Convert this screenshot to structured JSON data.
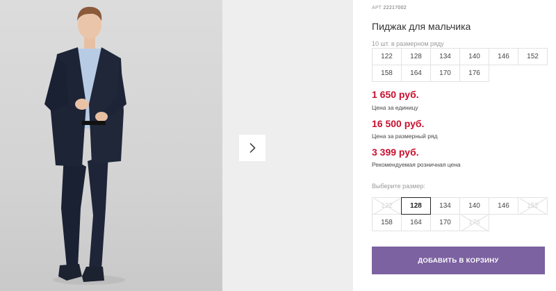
{
  "product": {
    "article_prefix": "АРТ",
    "article_number": "22217002",
    "title": "Пиджак для мальчика"
  },
  "pack": {
    "label": "10 шт. в размерном ряду",
    "sizes": [
      "122",
      "128",
      "134",
      "140",
      "146",
      "152",
      "158",
      "164",
      "170",
      "176"
    ]
  },
  "prices": [
    {
      "value": "1 650 руб.",
      "note": "Цена за единицу"
    },
    {
      "value": "16 500 руб.",
      "note": "Цена за размерный ряд"
    },
    {
      "value": "3 399 руб.",
      "note": "Рекомендуемая розничная цена"
    }
  ],
  "size_select": {
    "label": "Выберите размер:",
    "selected": "128",
    "sizes": [
      {
        "label": "122",
        "available": false
      },
      {
        "label": "128",
        "available": true
      },
      {
        "label": "134",
        "available": true
      },
      {
        "label": "140",
        "available": true
      },
      {
        "label": "146",
        "available": true
      },
      {
        "label": "152",
        "available": false
      },
      {
        "label": "158",
        "available": true
      },
      {
        "label": "164",
        "available": true
      },
      {
        "label": "170",
        "available": true
      },
      {
        "label": "176",
        "available": false
      }
    ]
  },
  "cart": {
    "button_label": "ДОБАВИТЬ В КОРЗИНУ"
  },
  "gallery": {
    "next_icon": "chevron-right-icon"
  },
  "colors": {
    "price": "#c8102e",
    "cart_button": "#7c62a0",
    "jacket": "#1c2436",
    "shirt": "#b7cce4"
  }
}
